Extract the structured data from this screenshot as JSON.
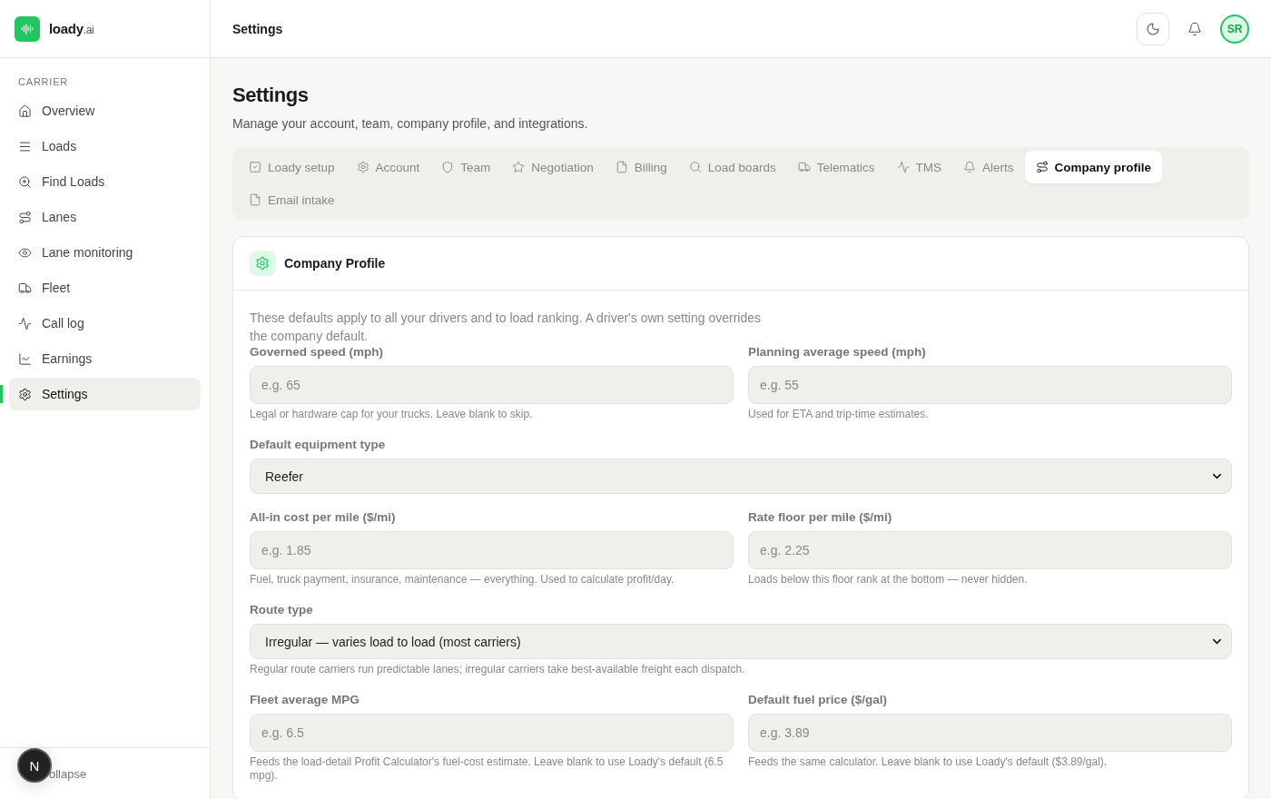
{
  "brand": {
    "name": "loady",
    "suffix": ".ai"
  },
  "sidebar": {
    "section": "CARRIER",
    "items": [
      {
        "label": "Overview",
        "kind": "home",
        "selected": false
      },
      {
        "label": "Loads",
        "kind": "list",
        "selected": false
      },
      {
        "label": "Find Loads",
        "kind": "zoom",
        "selected": false
      },
      {
        "label": "Lanes",
        "kind": "route",
        "selected": false
      },
      {
        "label": "Lane monitoring",
        "kind": "eye",
        "selected": false
      },
      {
        "label": "Fleet",
        "kind": "truck",
        "selected": false
      },
      {
        "label": "Call log",
        "kind": "pulse",
        "selected": false
      },
      {
        "label": "Earnings",
        "kind": "chart",
        "selected": false
      },
      {
        "label": "Settings",
        "kind": "gear",
        "selected": true
      }
    ],
    "collapse": "ollapse",
    "badge": "N"
  },
  "header": {
    "title": "Settings",
    "avatar": "SR"
  },
  "page": {
    "title": "Settings",
    "subtitle": "Manage your account, team, company profile, and integrations."
  },
  "tabs": [
    {
      "label": "Loady setup",
      "kind": "check",
      "selected": false
    },
    {
      "label": "Account",
      "kind": "gear",
      "selected": false
    },
    {
      "label": "Team",
      "kind": "shield",
      "selected": false
    },
    {
      "label": "Negotiation",
      "kind": "star",
      "selected": false
    },
    {
      "label": "Billing",
      "kind": "file",
      "selected": false
    },
    {
      "label": "Load boards",
      "kind": "search",
      "selected": false
    },
    {
      "label": "Telematics",
      "kind": "truck",
      "selected": false
    },
    {
      "label": "TMS",
      "kind": "pulse",
      "selected": false
    },
    {
      "label": "Alerts",
      "kind": "bell",
      "selected": false
    },
    {
      "label": "Company profile",
      "kind": "route",
      "selected": true
    },
    {
      "label": "Email intake",
      "kind": "file",
      "selected": false
    }
  ],
  "card": {
    "title": "Company Profile",
    "intro": "These defaults apply to all your drivers and to load ranking. A driver's own setting overrides the company default.",
    "rows": [
      {
        "fields": [
          {
            "kind": "input",
            "label": "Governed speed (mph)",
            "placeholder": "e.g. 65",
            "help": "Legal or hardware cap for your trucks. Leave blank to skip."
          },
          {
            "kind": "input",
            "label": "Planning average speed (mph)",
            "placeholder": "e.g. 55",
            "help": "Used for ETA and trip-time estimates."
          }
        ]
      },
      {
        "fields": [
          {
            "kind": "select",
            "label": "Default equipment type",
            "value": "Reefer"
          }
        ]
      },
      {
        "fields": [
          {
            "kind": "input",
            "label": "All-in cost per mile ($/mi)",
            "placeholder": "e.g. 1.85",
            "help": "Fuel, truck payment, insurance, maintenance — everything. Used to calculate profit/day."
          },
          {
            "kind": "input",
            "label": "Rate floor per mile ($/mi)",
            "placeholder": "e.g. 2.25",
            "help": "Loads below this floor rank at the bottom — never hidden."
          }
        ]
      },
      {
        "fields": [
          {
            "kind": "select",
            "label": "Route type",
            "value": "Irregular — varies load to load (most carriers)",
            "help": "Regular route carriers run predictable lanes; irregular carriers take best-available freight each dispatch."
          }
        ]
      },
      {
        "fields": [
          {
            "kind": "input",
            "label": "Fleet average MPG",
            "placeholder": "e.g. 6.5",
            "help": "Feeds the load-detail Profit Calculator's fuel-cost estimate. Leave blank to use Loady's default (6.5 mpg)."
          },
          {
            "kind": "input",
            "label": "Default fuel price ($/gal)",
            "placeholder": "e.g. 3.89",
            "help": "Feeds the same calculator. Leave blank to use Loady's default ($3.89/gal)."
          }
        ]
      }
    ]
  }
}
